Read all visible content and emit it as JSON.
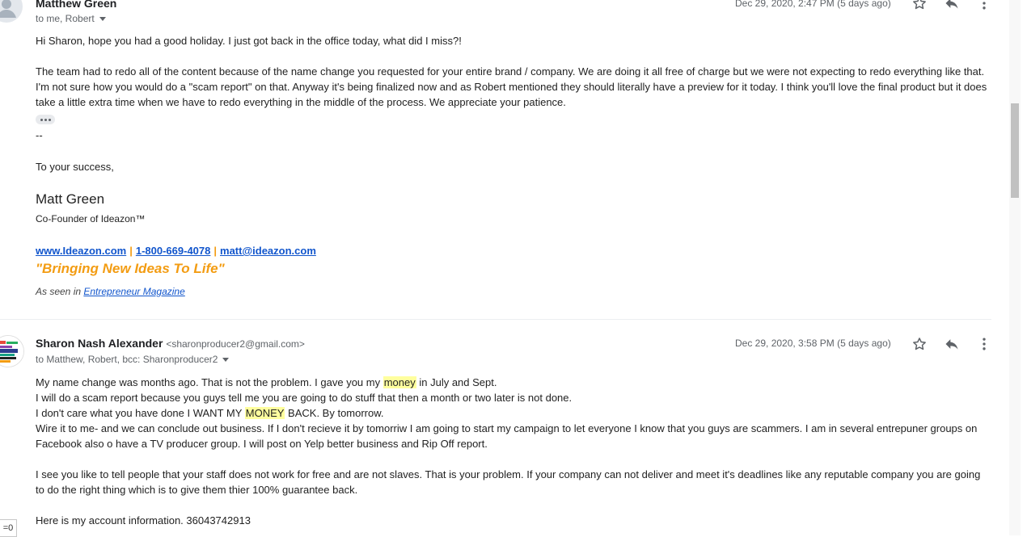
{
  "message1": {
    "sender_name": "Matthew Green",
    "recipients": "to me, Robert",
    "date": "Dec 29, 2020, 2:47 PM (5 days ago)",
    "body": {
      "greeting": "Hi Sharon, hope you had a good holiday. I just got back in the office today, what did I miss?!",
      "para_line1": "The team had to redo all of the content because of the name change you requested for your entire brand / company. We are doing it all free of charge but we were not expecting to redo everything like that.",
      "para_line2": "I'm not sure how you would do a \"scam report\" on that. Anyway it's being finalized now and as Robert mentioned they should literally have a preview for it today. I think you'll love the final product but it does",
      "para_line3": "take a little extra time when we have to redo everything in the middle of the process. We appreciate your patience."
    },
    "signature": {
      "separator": "--",
      "closing": "To your success,",
      "name": "Matt Green",
      "title": "Co-Founder of Ideazon™",
      "website": "www.Ideazon.com",
      "phone": "1-800-669-4078",
      "email": "matt@ideazon.com",
      "divider": "|",
      "tagline": "\"Bringing New Ideas To Life\"",
      "seen_in_prefix": "As seen in ",
      "seen_in_link": "Entrepreneur Magazine"
    }
  },
  "message2": {
    "sender_name": "Sharon Nash Alexander",
    "sender_email": "<sharonproducer2@gmail.com>",
    "recipients": "to Matthew, Robert, bcc: Sharonproducer2",
    "date": "Dec 29, 2020, 3:58 PM (5 days ago)",
    "body": {
      "l1_a": "My name change was months ago.   That is not the problem.  I gave you my ",
      "l1_hl": "money",
      "l1_b": " in July and Sept.",
      "l2": "I will do a scam report because you guys tell me you are going to do stuff that then a month or two later is not done.",
      "l3_a": "I don't care what you have done I WANT MY ",
      "l3_hl": "MONEY",
      "l3_b": " BACK.   By tomorrow.",
      "l4": "Wire it to me- and we can conclude out business.     If I don't recieve it by tomorriw I am going to start my campaign to let everyone I know that you guys are scammers.  I am in several entrepuner groups on",
      "l5": "Facebook also o have a TV producer group.  I will post on Yelp  better business and Rip Off report.",
      "l6": "I see you like to tell people that your staff does not work for free and are not slaves.  That is your problem.  If your company can not deliver and meet it's deadlines like any reputable company you are going",
      "l7": "to do the right thing which is to give them thier 100% guarantee back.",
      "l8": "Here is my account information.  36043742913"
    }
  },
  "corner_label": "=0",
  "icons": [
    "person-icon",
    "star-icon",
    "reply-icon",
    "more-vert-icon",
    "chevron-down-icon"
  ]
}
